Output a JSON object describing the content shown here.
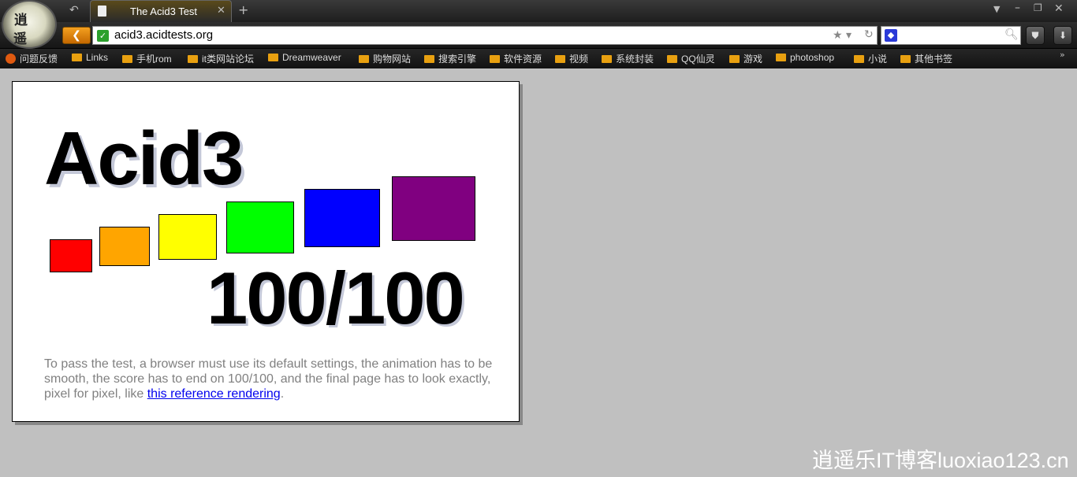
{
  "browser": {
    "tab": {
      "title": "The Acid3 Test"
    },
    "address_bar": {
      "url": "acid3.acidtests.org"
    },
    "avatar_text": [
      "逍",
      "遥"
    ],
    "bookmarks": [
      "问题反馈",
      "Links",
      "手机rom",
      "it类网站论坛",
      "Dreamweaver",
      "购物网站",
      "搜索引擎",
      "软件资源",
      "视频",
      "系统封装",
      "QQ仙灵",
      "游戏",
      "photoshop",
      "小说",
      "其他书签"
    ]
  },
  "page": {
    "heading": "Acid3",
    "score": "100/100",
    "instructions": "To pass the test, a browser must use its default settings, the animation has to be smooth, the score has to end on 100/100, and the final page has to look exactly, pixel for pixel, like ",
    "reference_link": "this reference rendering",
    "instructions_end": ".",
    "bucket_colors": [
      "#ff0000",
      "#ffa500",
      "#ffff00",
      "#00ff00",
      "#0000ff",
      "#800080"
    ]
  },
  "watermark": "逍遥乐IT博客luoxiao123.cn"
}
